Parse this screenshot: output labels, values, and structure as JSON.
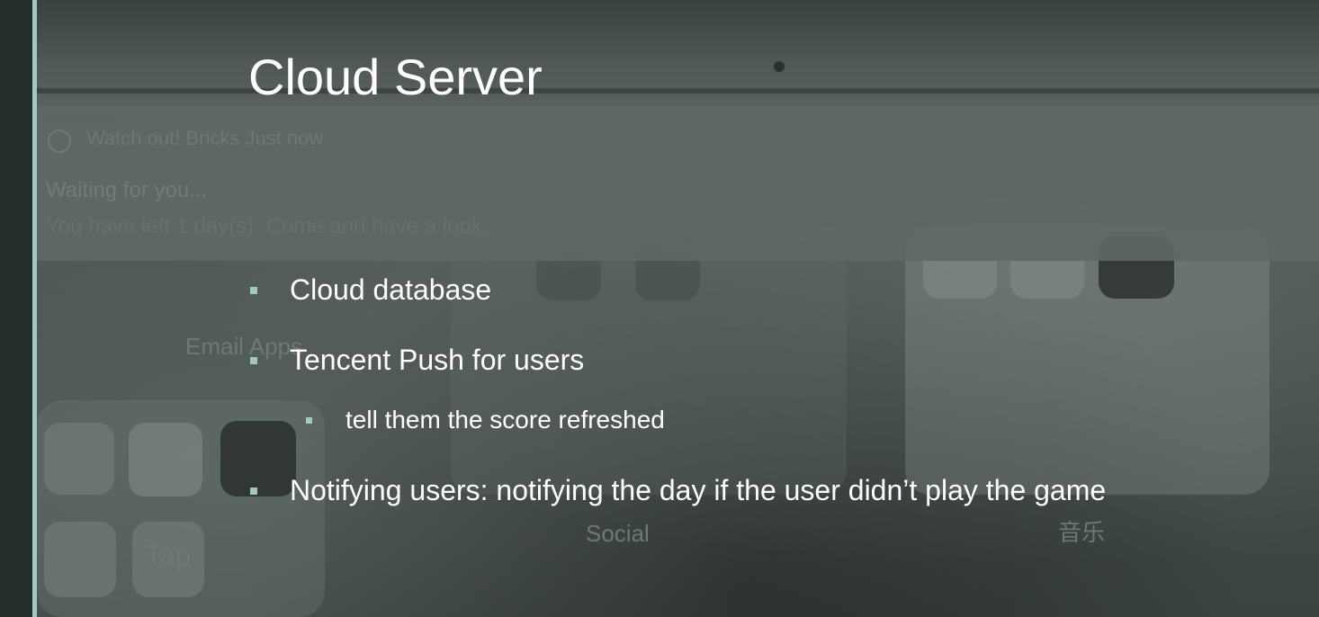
{
  "slide": {
    "title": "Cloud Server",
    "bullets": [
      {
        "text": "Cloud database"
      },
      {
        "text": "Tencent Push for users"
      },
      {
        "text": "Notifying users: notifying the day if the user didn’t play the game"
      }
    ],
    "sub_bullets": [
      {
        "text": "tell them the score refreshed"
      }
    ],
    "accent_color": "#9fc9c2"
  },
  "background_screenshot": {
    "notification": {
      "app_line": "Watch out! Bricks   Just now",
      "title": "Waiting for you...",
      "body": "You have left 1 day(s). Come and have a look."
    },
    "labels": {
      "email_apps": "Email Apps",
      "social": "Social",
      "tap": "Tap",
      "music": "音乐"
    }
  }
}
